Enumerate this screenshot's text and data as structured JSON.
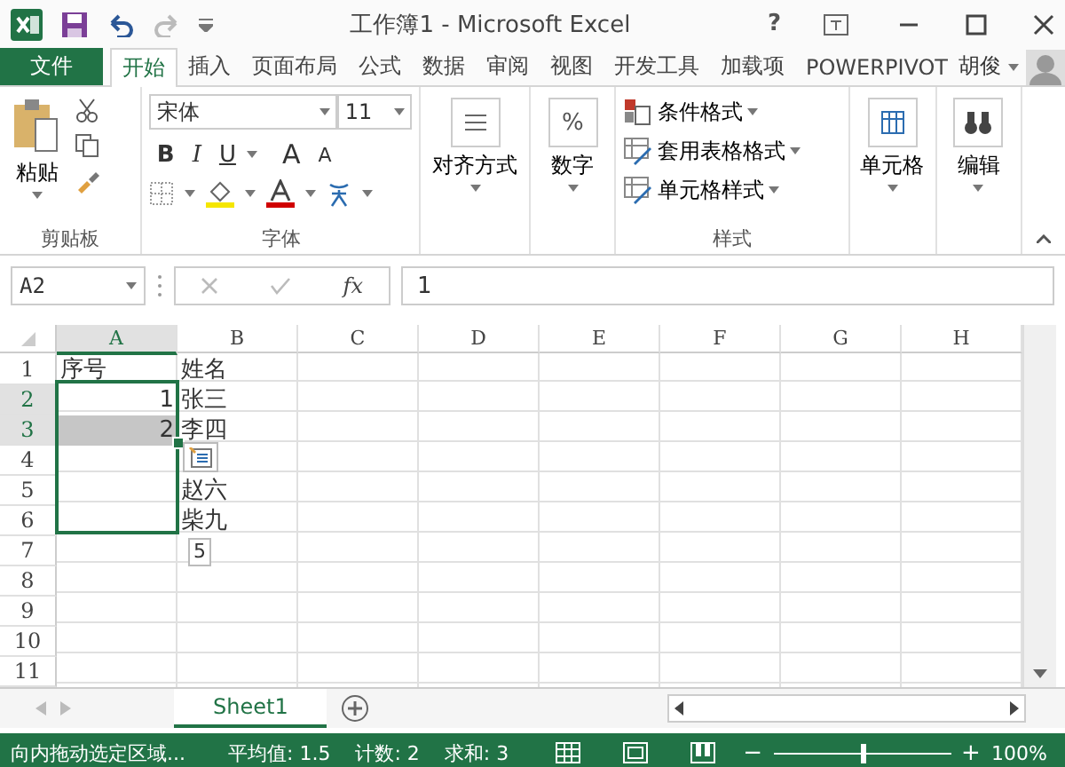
{
  "window": {
    "title": "工作簿1 - Microsoft Excel",
    "help": "?"
  },
  "tabs": [
    {
      "label": "文件",
      "kind": "file",
      "selected": false
    },
    {
      "label": "开始",
      "kind": "tab",
      "selected": true
    },
    {
      "label": "插入",
      "kind": "tab",
      "selected": false
    },
    {
      "label": "页面布局",
      "kind": "tab",
      "selected": false
    },
    {
      "label": "公式",
      "kind": "tab",
      "selected": false
    },
    {
      "label": "数据",
      "kind": "tab",
      "selected": false
    },
    {
      "label": "审阅",
      "kind": "tab",
      "selected": false
    },
    {
      "label": "视图",
      "kind": "tab",
      "selected": false
    },
    {
      "label": "开发工具",
      "kind": "tab",
      "selected": false
    },
    {
      "label": "加载项",
      "kind": "tab",
      "selected": false
    },
    {
      "label": "POWERPIVOT",
      "kind": "tab",
      "selected": false
    }
  ],
  "user": {
    "name": "胡俊"
  },
  "ribbon": {
    "clipboard": {
      "paste": "粘贴",
      "label": "剪贴板"
    },
    "font": {
      "family": "宋体",
      "size": "11",
      "bold": "B",
      "italic": "I",
      "underline": "U",
      "grow": "A",
      "shrink": "A",
      "label": "字体"
    },
    "alignment": {
      "label": "对齐方式"
    },
    "number": {
      "symbol": "%",
      "label": "数字"
    },
    "styles": {
      "items": [
        "条件格式",
        "套用表格格式",
        "单元格样式"
      ],
      "label": "样式"
    },
    "cells": {
      "label": "单元格"
    },
    "editing": {
      "label": "编辑"
    }
  },
  "formula_bar": {
    "name_box": "A2",
    "fx": "fx",
    "value": "1"
  },
  "columns": [
    {
      "label": "A",
      "selected": true
    },
    {
      "label": "B",
      "selected": false
    },
    {
      "label": "C",
      "selected": false
    },
    {
      "label": "D",
      "selected": false
    },
    {
      "label": "E",
      "selected": false
    },
    {
      "label": "F",
      "selected": false
    },
    {
      "label": "G",
      "selected": false
    },
    {
      "label": "H",
      "selected": false
    }
  ],
  "rows": [
    {
      "label": "1",
      "selected": false,
      "cells": [
        {
          "text": "序号",
          "kind": "text",
          "selected": false,
          "shaded": false
        },
        {
          "text": "姓名",
          "kind": "text"
        }
      ]
    },
    {
      "label": "2",
      "selected": true,
      "cells": [
        {
          "text": "1",
          "kind": "number",
          "selected": true,
          "shaded": false
        },
        {
          "text": "张三",
          "kind": "text"
        }
      ]
    },
    {
      "label": "3",
      "selected": true,
      "cells": [
        {
          "text": "2",
          "kind": "number",
          "selected": true,
          "shaded": true
        },
        {
          "text": "李四",
          "kind": "text"
        }
      ]
    },
    {
      "label": "4",
      "selected": false,
      "cells": [
        {
          "text": "",
          "kind": "text",
          "selected": true,
          "shaded": false
        }
      ]
    },
    {
      "label": "5",
      "selected": false,
      "cells": [
        {
          "text": "",
          "kind": "text",
          "selected": true,
          "shaded": false
        },
        {
          "text": "赵六",
          "kind": "text"
        }
      ]
    },
    {
      "label": "6",
      "selected": false,
      "cells": [
        {
          "text": "",
          "kind": "text",
          "selected": true,
          "shaded": false
        },
        {
          "text": "柴九",
          "kind": "text"
        }
      ]
    },
    {
      "label": "7",
      "selected": false,
      "cells": []
    },
    {
      "label": "8",
      "selected": false,
      "cells": []
    },
    {
      "label": "9",
      "selected": false,
      "cells": []
    },
    {
      "label": "10",
      "selected": false,
      "cells": []
    },
    {
      "label": "11",
      "selected": false,
      "cells": []
    }
  ],
  "fill_tooltip": "5",
  "sheets": [
    {
      "label": "Sheet1",
      "selected": true
    }
  ],
  "status_bar": {
    "message": "向内拖动选定区域...",
    "average": "平均值: 1.5",
    "count": "计数: 2",
    "sum": "求和: 3",
    "zoom": {
      "zoom_out": "−",
      "level": 0.5,
      "zoom_in": "+",
      "reading": "100%"
    }
  }
}
